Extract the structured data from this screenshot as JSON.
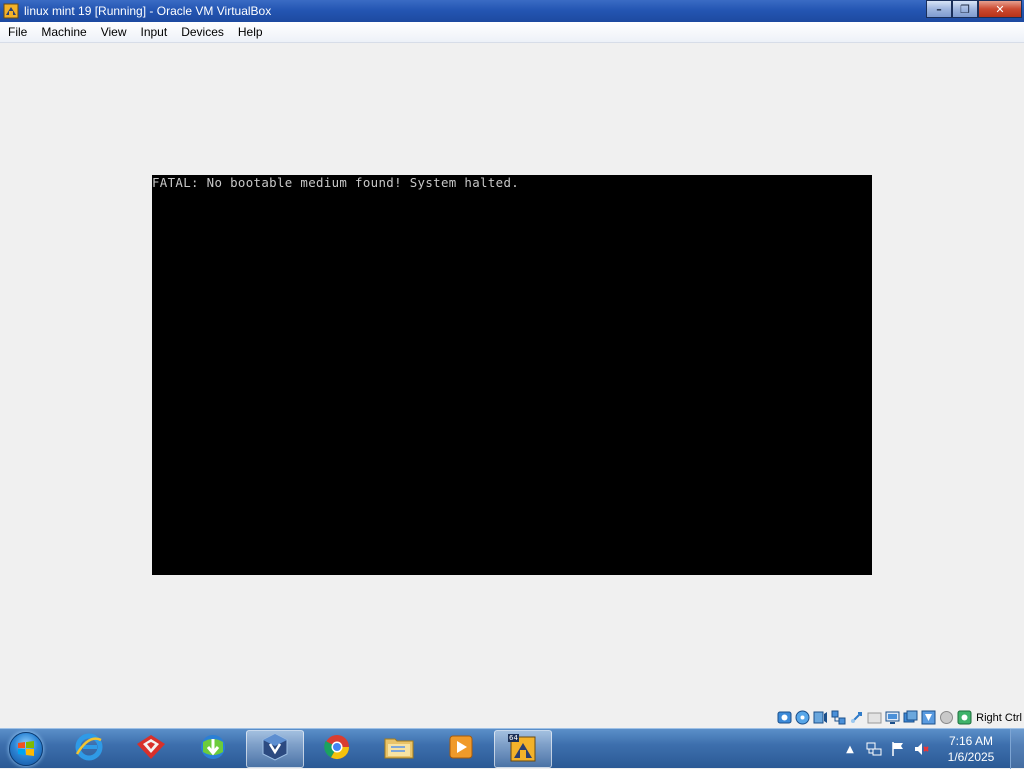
{
  "window": {
    "title": "linux mint 19 [Running] - Oracle VM VirtualBox",
    "controls": {
      "minimize": "–",
      "restore": "❐",
      "close": "✕"
    }
  },
  "menu": {
    "items": [
      "File",
      "Machine",
      "View",
      "Input",
      "Devices",
      "Help"
    ]
  },
  "vm": {
    "console_line": "FATAL: No bootable medium found! System halted."
  },
  "statusbar": {
    "icons": [
      "hard-disk-icon",
      "optical-drive-icon",
      "audio-icon",
      "network-icon",
      "usb-icon",
      "shared-folders-icon",
      "display-icon",
      "video-capture-icon",
      "recording-icon",
      "cpu-icon",
      "mouse-integration-icon"
    ],
    "host_key": "Right Ctrl"
  },
  "taskbar": {
    "apps": [
      "internet-explorer-icon",
      "foxit-reader-icon",
      "internet-download-manager-icon",
      "virtualbox-icon",
      "chrome-icon",
      "file-explorer-icon",
      "media-player-icon",
      "virtualbox-vm-icon"
    ],
    "active_app_badge": "64"
  },
  "tray": {
    "time": "7:16 AM",
    "date": "1/6/2025"
  }
}
